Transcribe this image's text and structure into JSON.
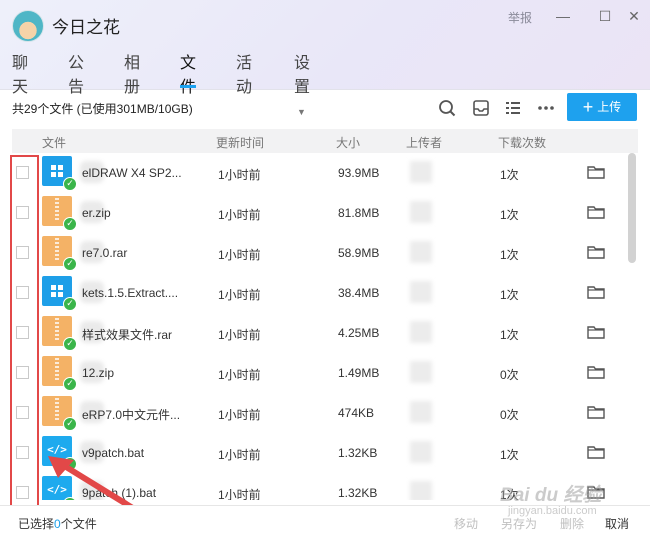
{
  "window": {
    "group_name": "今日之花",
    "report_label": "举报",
    "minimize_symbol": "—",
    "maximize_symbol": "☐",
    "close_symbol": "✕"
  },
  "nav": {
    "tabs": [
      {
        "label": "聊天"
      },
      {
        "label": "公告"
      },
      {
        "label": "相册"
      },
      {
        "label": "文件",
        "active": true
      },
      {
        "label": "活动"
      },
      {
        "label": "设置",
        "has_dropdown": true
      }
    ]
  },
  "toolbar": {
    "summary": "共29个文件 (已使用301MB/10GB)",
    "upload_label": "上传",
    "icons": [
      "search-icon",
      "inbox-icon",
      "list-view-icon",
      "more-icon"
    ]
  },
  "table": {
    "headers": {
      "name": "文件",
      "time": "更新时间",
      "size": "大小",
      "uploader": "上传者",
      "downloads": "下载次数"
    },
    "rows": [
      {
        "icon": "windows-exe",
        "name": "elDRAW X4 SP2...",
        "time": "1小时前",
        "size": "93.9MB",
        "downloads": "1次"
      },
      {
        "icon": "zip",
        "name": "er.zip",
        "time": "1小时前",
        "size": "81.8MB",
        "downloads": "1次"
      },
      {
        "icon": "zip",
        "name": "re7.0.rar",
        "time": "1小时前",
        "size": "58.9MB",
        "downloads": "1次"
      },
      {
        "icon": "windows-exe",
        "name": "kets.1.5.Extract....",
        "time": "1小时前",
        "size": "38.4MB",
        "downloads": "1次"
      },
      {
        "icon": "zip",
        "name": "样式效果文件.rar",
        "time": "1小时前",
        "size": "4.25MB",
        "downloads": "1次"
      },
      {
        "icon": "zip",
        "name": "12.zip",
        "time": "1小时前",
        "size": "1.49MB",
        "downloads": "0次"
      },
      {
        "icon": "zip",
        "name": "eRP7.0中文元件...",
        "time": "1小时前",
        "size": "474KB",
        "downloads": "0次"
      },
      {
        "icon": "bat",
        "name": "v9patch.bat",
        "time": "1小时前",
        "size": "1.32KB",
        "downloads": "1次"
      },
      {
        "icon": "bat",
        "name": "9patch (1).bat",
        "time": "1小时前",
        "size": "1.32KB",
        "downloads": "1次"
      }
    ]
  },
  "footer": {
    "selected_prefix": "已选择",
    "selected_count": "0",
    "selected_suffix": "个文件",
    "move_label": "移动",
    "save_as_label": "另存为",
    "delete_label": "删除",
    "cancel_label": "取消"
  },
  "watermark": {
    "text": "Bai du 经验",
    "sub": "jingyan.baidu.com"
  },
  "colors": {
    "accent": "#1ea1ee",
    "highlight_box": "#e24848",
    "check_green": "#3bb54a"
  }
}
